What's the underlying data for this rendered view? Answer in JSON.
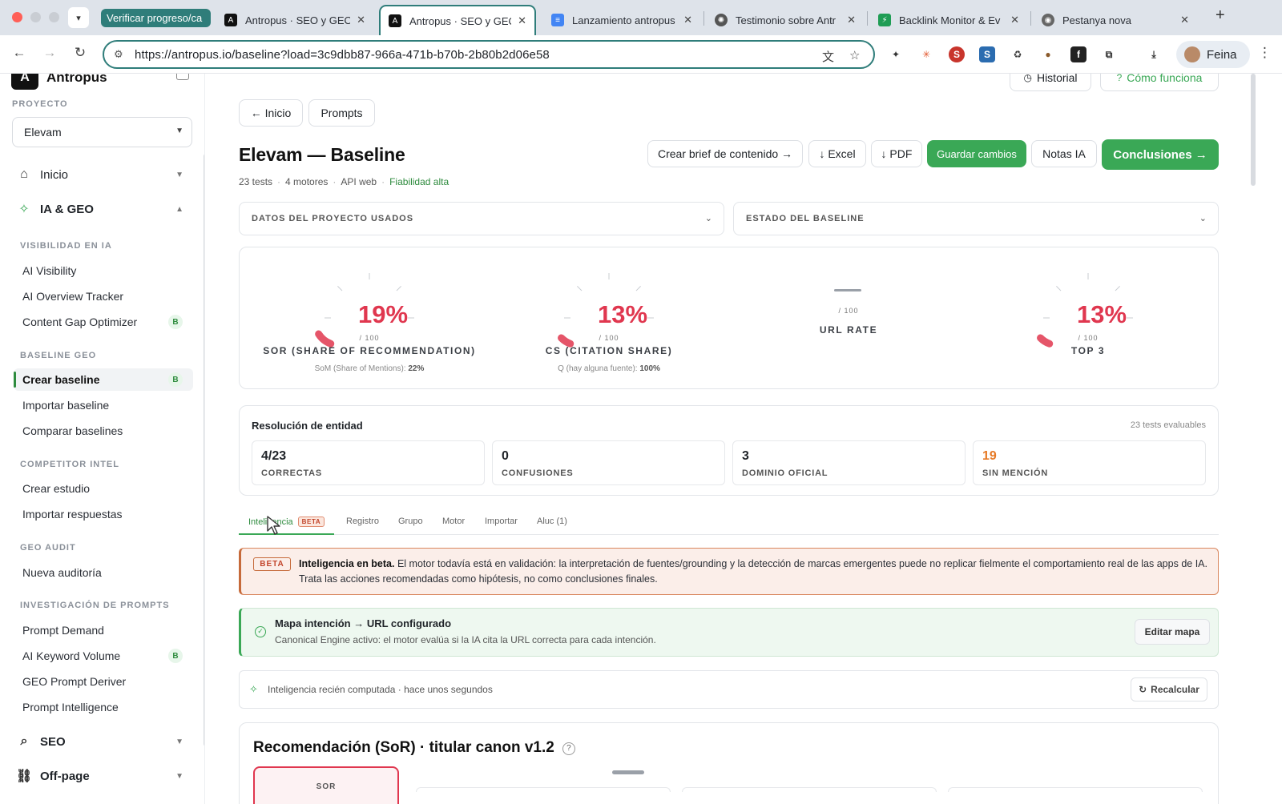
{
  "browser": {
    "tab_group": "Verificar progreso/ca",
    "tabs": [
      {
        "label": "Antropus · SEO y GEO",
        "favicon": "antropus-icon",
        "color": "#111111"
      },
      {
        "label": "Antropus · SEO y GEO",
        "favicon": "antropus-icon",
        "color": "#111111",
        "active": true
      },
      {
        "label": "Lanzamiento antropus",
        "favicon": "docs-icon",
        "color": "#4285f4"
      },
      {
        "label": "Testimonio sobre Antr",
        "favicon": "chatgpt-icon",
        "color": "#555555"
      },
      {
        "label": "Backlink Monitor & Ev",
        "favicon": "bolt-icon",
        "color": "#1f9d55"
      },
      {
        "label": "Pestanya nova",
        "favicon": "chrome-icon",
        "color": "#666666"
      }
    ],
    "url": "https://antropus.io/baseline?load=3c9dbb87-966a-471b-b70b-2b80b2d06e58",
    "profile_name": "Feina"
  },
  "sidebar": {
    "brand": "Antropus",
    "project_label": "PROYECTO",
    "project_value": "Elevam",
    "main_items": {
      "inicio": "Inicio",
      "ia_geo": "IA & GEO",
      "seo": "SEO",
      "offpage": "Off-page"
    },
    "sections": {
      "visibilidad": "VISIBILIDAD EN IA",
      "baseline": "BASELINE GEO",
      "competitor": "COMPETITOR INTEL",
      "audit": "GEO AUDIT",
      "prompts": "INVESTIGACIÓN DE PROMPTS"
    },
    "items": {
      "ai_visibility": "AI Visibility",
      "ai_overview": "AI Overview Tracker",
      "content_gap": "Content Gap Optimizer",
      "crear_baseline": "Crear baseline",
      "importar_baseline": "Importar baseline",
      "comparar_baselines": "Comparar baselines",
      "crear_estudio": "Crear estudio",
      "importar_respuestas": "Importar respuestas",
      "nueva_auditoria": "Nueva auditoría",
      "prompt_demand": "Prompt Demand",
      "ai_keyword_volume": "AI Keyword Volume",
      "geo_prompt_deriver": "GEO Prompt Deriver",
      "prompt_intelligence": "Prompt Intelligence"
    },
    "badge": "B"
  },
  "header": {
    "historial": "Historial",
    "como_funciona": "Cómo funciona",
    "back": "← Inicio",
    "prompts": "Prompts",
    "title": "Elevam — Baseline",
    "meta": {
      "tests": "23 tests",
      "motores": "4 motores",
      "api": "API web",
      "fiabilidad": "Fiabilidad alta"
    },
    "actions": {
      "brief": "Crear brief de contenido →",
      "excel": "↓ Excel",
      "pdf": "↓ PDF",
      "guardar": "Guardar cambios",
      "notas": "Notas IA",
      "conclusiones": "Conclusiones →"
    }
  },
  "accordions": {
    "datos": "DATOS DEL PROYECTO USADOS",
    "estado": "ESTADO DEL BASELINE"
  },
  "gauges": [
    {
      "value": "19%",
      "fraction": 0.19,
      "scale": "/ 100",
      "name": "SOR (SHARE OF RECOMMENDATION)",
      "foot_label": "SoM (Share of Mentions):",
      "foot_value": "22%"
    },
    {
      "value": "13%",
      "fraction": 0.13,
      "scale": "/ 100",
      "name": "CS (CITATION SHARE)",
      "foot_label": "Q (hay alguna fuente):",
      "foot_value": "100%"
    },
    {
      "value": "",
      "fraction": 0,
      "scale": "/ 100",
      "name": "URL RATE",
      "foot_label": "",
      "foot_value": ""
    },
    {
      "value": "13%",
      "fraction": 0.13,
      "scale": "/ 100",
      "name": "TOP 3",
      "foot_label": "",
      "foot_value": ""
    }
  ],
  "entity": {
    "title": "Resolución de entidad",
    "count": "23 tests evaluables",
    "stats": [
      {
        "value": "4/23",
        "label": "CORRECTAS"
      },
      {
        "value": "0",
        "label": "CONFUSIONES"
      },
      {
        "value": "3",
        "label": "DOMINIO OFICIAL"
      },
      {
        "value": "19",
        "label": "SIN MENCIÓN"
      }
    ]
  },
  "tabs": {
    "inteligencia": "Inteligencia",
    "beta": "BETA",
    "registro": "Registro",
    "grupo": "Grupo",
    "motor": "Motor",
    "importar": "Importar",
    "aluc": "Aluc (1)"
  },
  "beta_banner": {
    "chip": "BETA",
    "title": "Inteligencia en beta.",
    "text": "El motor todavía está en validación: la interpretación de fuentes/grounding y la detección de marcas emergentes puede no replicar fielmente el comportamiento real de las apps de IA. Trata las acciones recomendadas como hipótesis, no como conclusiones finales."
  },
  "map": {
    "title": "Mapa intención → URL configurado",
    "text": "Canonical Engine activo: el motor evalúa si la IA cita la URL correcta para cada intención.",
    "button": "Editar mapa"
  },
  "intel": {
    "text": "Inteligencia recién computada · hace unos segundos",
    "button": "Recalcular"
  },
  "sor": {
    "title": "Recomendación (SoR) · titular canon v1.2",
    "help": "?",
    "box_label": "SOR"
  },
  "colors": {
    "accent": "#3aa856",
    "danger": "#e0374f",
    "warning": "#e67a26",
    "teal": "#2f7d7a"
  }
}
